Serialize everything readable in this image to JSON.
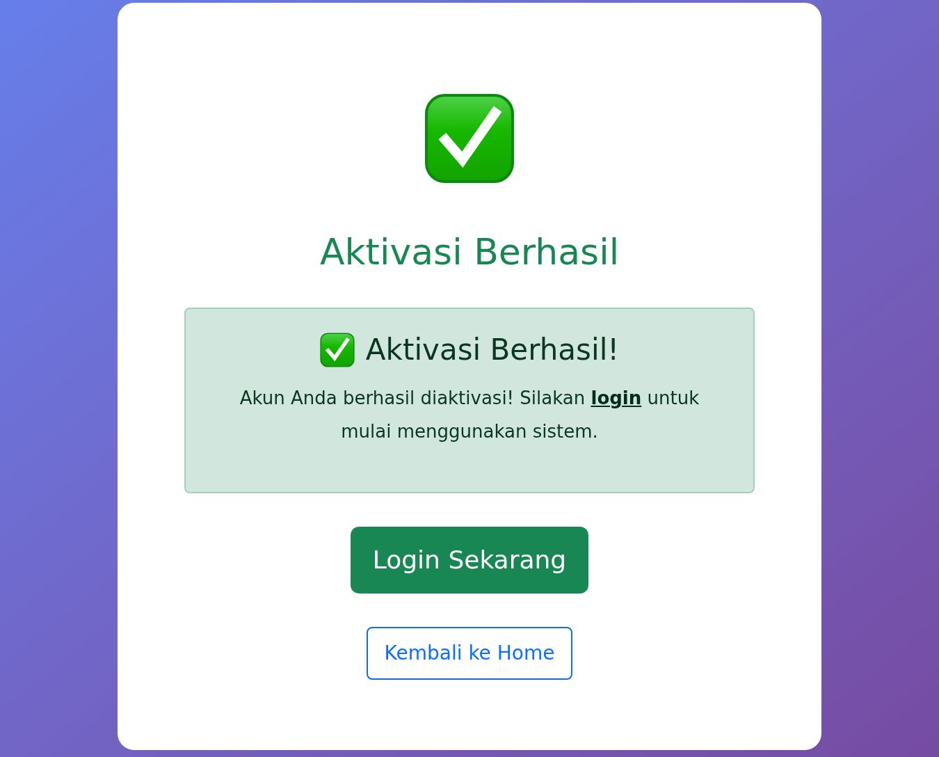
{
  "card": {
    "title": "Aktivasi Berhasil",
    "alert": {
      "heading": "Aktivasi Berhasil!",
      "text_before": "Akun Anda berhasil diaktivasi! Silakan",
      "link": "login",
      "text_after": "untuk mulai menggunakan sistem."
    },
    "buttons": [
      {
        "label": "Login Sekarang",
        "kind": "primary"
      },
      {
        "label": "Kembali ke Home",
        "kind": "outline"
      }
    ]
  }
}
